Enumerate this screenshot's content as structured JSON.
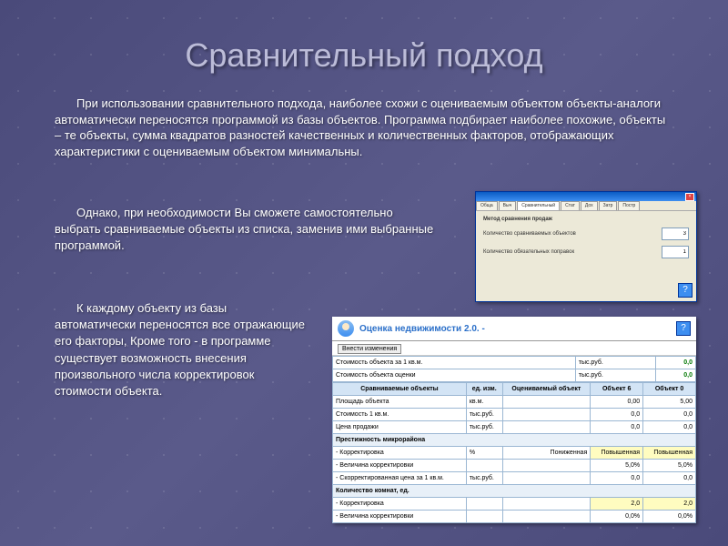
{
  "title": "Сравнительный подход",
  "p1": "При использовании сравнительного подхода, наиболее схожи с оцениваемым объектом объекты-аналоги автоматически переносятся программой из базы объектов. Программа подбирает наиболее похожие, объекты – те объекты, сумма квадратов разностей качественных и количественных факторов, отображающих характеристики с оцениваемым объектом минимальны.",
  "p2": "Однако, при необходимости Вы сможете самостоятельно выбрать сравниваемые объекты из списка, заменив ими выбранные программой.",
  "p3": "К каждому объекту из базы автоматически переносятся все отражающие его факторы, Кроме того - в программе существует возможность внесения произвольного числа корректировок стоимости объекта.",
  "screenshot1": {
    "tab_active": "Сравнительный",
    "label1": "Метод сравнения продаж",
    "row1": "Количество сравниваемых объектов",
    "row2": "Количество обязательных поправок",
    "val1": "3",
    "val2": "1",
    "help": "?"
  },
  "screenshot2": {
    "app_title": "Оценка недвижимости 2.0. -",
    "btn": "Внести изменения",
    "help": "?",
    "top_rows": [
      {
        "label": "Стоимость объекта за 1 кв.м.",
        "unit": "тыс.руб.",
        "val": "0,0"
      },
      {
        "label": "Стоимость объекта оценки",
        "unit": "тыс.руб.",
        "val": "0,0"
      }
    ],
    "headers": [
      "Сравниваемые объекты",
      "ед. изм.",
      "Оцениваемый объект",
      "Объект 6",
      "Объект 0"
    ],
    "rows": [
      {
        "cells": [
          "Площадь объекта",
          "кв.м.",
          "",
          "0,00",
          "5,00"
        ]
      },
      {
        "cells": [
          "Стоимость 1 кв.м.",
          "тыс.руб.",
          "",
          "0,0",
          "0,0"
        ]
      },
      {
        "cells": [
          "Цена продажи",
          "тыс.руб.",
          "",
          "0,0",
          "0,0"
        ]
      },
      {
        "section": "Престижность микрорайона"
      },
      {
        "cells": [
          "- Корректировка",
          "%",
          "Пониженная",
          "Повышенная",
          "Повышенная"
        ],
        "yel": true
      },
      {
        "cells": [
          "- Величина корректировки",
          "",
          "",
          "5,0%",
          "5,0%"
        ]
      },
      {
        "cells": [
          "- Скорректированная цена за 1 кв.м.",
          "тыс.руб.",
          "",
          "0,0",
          "0,0"
        ]
      },
      {
        "section": "Количество комнат, ед."
      },
      {
        "cells": [
          "- Корректировка",
          "",
          "",
          "2,0",
          "2,0"
        ],
        "yel": true
      },
      {
        "cells": [
          "- Величина корректировки",
          "",
          "",
          "0,0%",
          "0,0%"
        ]
      }
    ]
  }
}
